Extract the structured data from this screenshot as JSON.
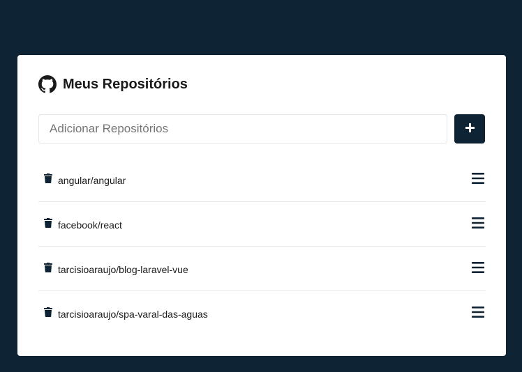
{
  "header": {
    "title": "Meus Repositórios",
    "icon": "github-icon"
  },
  "form": {
    "input_placeholder": "Adicionar Repositórios",
    "input_value": "",
    "add_button_label": "+",
    "add_button_icon": "plus-icon"
  },
  "repositories": [
    {
      "name": "angular/angular",
      "delete_icon": "trash-icon",
      "menu_icon": "bars-icon"
    },
    {
      "name": "facebook/react",
      "delete_icon": "trash-icon",
      "menu_icon": "bars-icon"
    },
    {
      "name": "tarcisioaraujo/blog-laravel-vue",
      "delete_icon": "trash-icon",
      "menu_icon": "bars-icon"
    },
    {
      "name": "tarcisioaraujo/spa-varal-das-aguas",
      "delete_icon": "trash-icon",
      "menu_icon": "bars-icon"
    }
  ],
  "colors": {
    "background": "#0e2333",
    "card": "#ffffff",
    "accent": "#0e2333",
    "text": "#1a1a1a",
    "divider": "#e6e6e6"
  }
}
